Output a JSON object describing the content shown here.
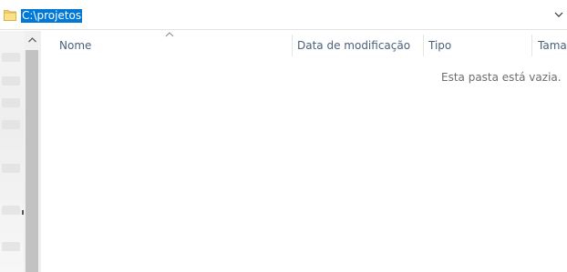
{
  "address_bar": {
    "path": "C:\\projetos",
    "folder_icon": "folder-icon",
    "dropdown_icon": "chevron-down-icon"
  },
  "columns": [
    {
      "label": "Nome"
    },
    {
      "label": "Data de modificação"
    },
    {
      "label": "Tipo"
    },
    {
      "label": "Tamar"
    }
  ],
  "sort_indicator_icon": "caret-up-icon",
  "empty_message": "Esta pasta está vazia.",
  "colors": {
    "selection": "#0078d7",
    "header_text": "#4c607a",
    "folder": "#f8d775"
  }
}
